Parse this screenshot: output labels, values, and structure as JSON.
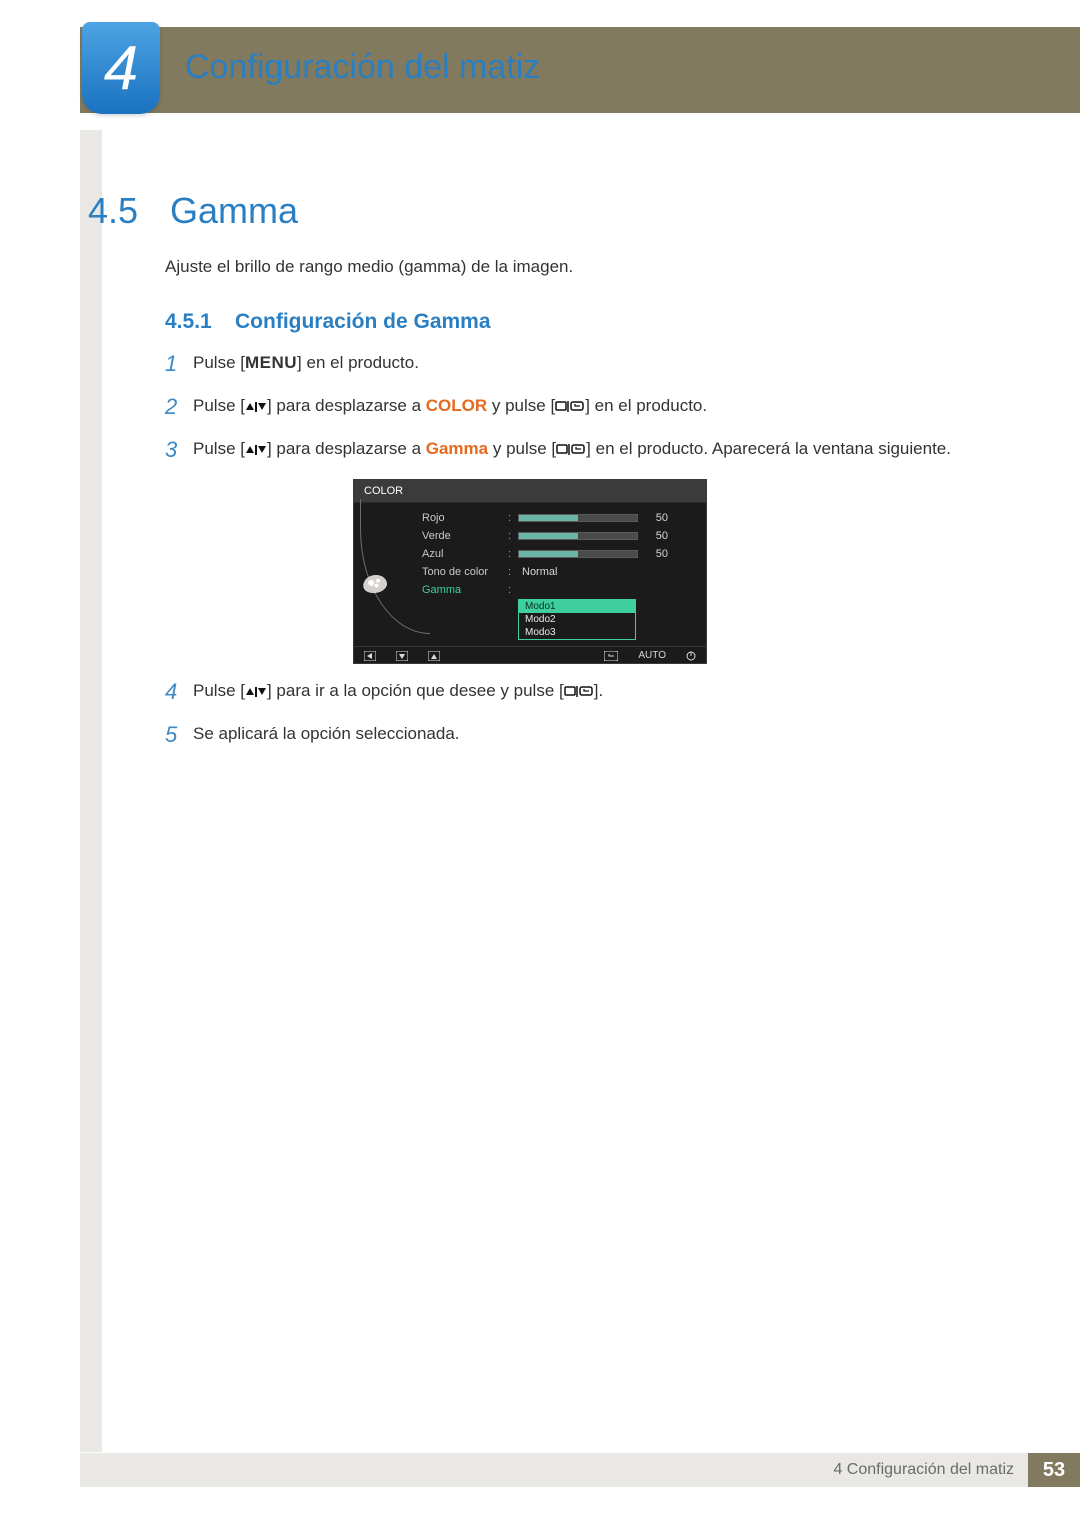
{
  "header": {
    "chapter_num": "4",
    "title": "Configuración del matiz"
  },
  "section": {
    "num": "4.5",
    "title": "Gamma",
    "intro": "Ajuste el brillo de rango medio (gamma) de la imagen."
  },
  "subsection": {
    "num": "4.5.1",
    "title": "Configuración de Gamma"
  },
  "steps": {
    "1": {
      "pre": "Pulse [",
      "menu": "MENU",
      "post": "] en el producto."
    },
    "2": {
      "pre": "Pulse [",
      "mid1": "] para desplazarse a ",
      "highlight": "COLOR",
      "mid2": " y pulse [",
      "post": "] en el producto."
    },
    "3": {
      "pre": "Pulse [",
      "mid1": "] para desplazarse a ",
      "highlight": "Gamma",
      "mid2": " y pulse [",
      "post": "] en el producto. Aparecerá la ventana siguiente."
    },
    "4": {
      "pre": "Pulse [",
      "mid": "] para ir a la opción que desee y pulse [",
      "post": "]."
    },
    "5": {
      "text": "Se aplicará la opción seleccionada."
    }
  },
  "step_nums": {
    "1": "1",
    "2": "2",
    "3": "3",
    "4": "4",
    "5": "5"
  },
  "osd": {
    "title": "COLOR",
    "rows": {
      "rojo": {
        "label": "Rojo",
        "value": "50"
      },
      "verde": {
        "label": "Verde",
        "value": "50"
      },
      "azul": {
        "label": "Azul",
        "value": "50"
      },
      "tono": {
        "label": "Tono de color",
        "value": "Normal"
      },
      "gamma": {
        "label": "Gamma"
      }
    },
    "options": {
      "modo1": "Modo1",
      "modo2": "Modo2",
      "modo3": "Modo3"
    },
    "footer": {
      "auto": "AUTO"
    }
  },
  "footer": {
    "chapter_label": "4 Configuración del matiz",
    "page": "53"
  }
}
